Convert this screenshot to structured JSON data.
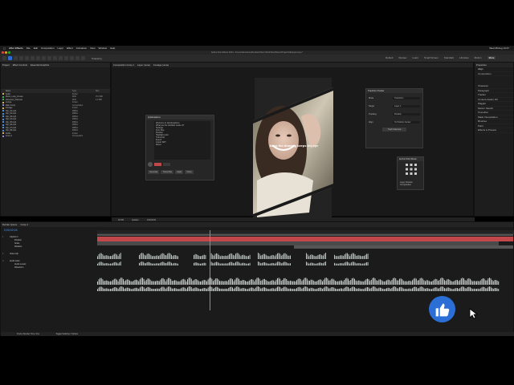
{
  "menubar": {
    "app_name": "After Effects",
    "items": [
      "File",
      "Edit",
      "Composition",
      "Layer",
      "Effect",
      "Animation",
      "View",
      "Window",
      "Help"
    ],
    "clock": "Wed 28 Aug 13:47"
  },
  "window": {
    "title": "Adobe After Effects 2024 - /Users/clientname/Desktop/Client Work/ClientName/Project/AE/project.aep *"
  },
  "toolbar": {
    "snapping_label": "Snapping"
  },
  "workspace": {
    "tabs": [
      "Default",
      "Review",
      "Learn",
      "Small Screen",
      "Standard",
      "Libraries",
      "Motion",
      "More"
    ],
    "active": "More"
  },
  "project_panel": {
    "tabs": [
      "Project",
      "Effect Controls",
      "Essential Graphics"
    ],
    "columns": [
      "Name",
      "Type",
      "Size"
    ],
    "items": [
      {
        "name": "Audio",
        "type": "Folder",
        "size": "",
        "color": "#d9b34a"
      },
      {
        "name": "Music_Loop_01.wav",
        "type": "WAV",
        "size": "15.3 MB",
        "color": "#3fae5a"
      },
      {
        "name": "Voiceover_final.wav",
        "type": "WAV",
        "size": "4.2 MB",
        "color": "#3fae5a"
      },
      {
        "name": "Comps",
        "type": "Folder",
        "size": "",
        "color": "#d9b34a"
      },
      {
        "name": "Main Comp",
        "type": "Composition",
        "size": "",
        "color": "#8a8ad9"
      },
      {
        "name": "Footage",
        "type": "Folder",
        "size": "",
        "color": "#d9b34a"
      },
      {
        "name": "Clip_01.mp4",
        "type": "MPEG",
        "size": "",
        "color": "#4a90d9"
      },
      {
        "name": "Clip_02.mp4",
        "type": "MPEG",
        "size": "",
        "color": "#4a90d9"
      },
      {
        "name": "Clip_03.mp4",
        "type": "MPEG",
        "size": "",
        "color": "#4a90d9"
      },
      {
        "name": "Clip_04.mp4",
        "type": "MPEG",
        "size": "",
        "color": "#4a90d9"
      },
      {
        "name": "Clip_05.mp4",
        "type": "MPEG",
        "size": "",
        "color": "#4a90d9"
      },
      {
        "name": "Clip_06.mp4",
        "type": "MPEG",
        "size": "",
        "color": "#4a90d9"
      },
      {
        "name": "Clip_07.mp4",
        "type": "MPEG",
        "size": "",
        "color": "#4a90d9"
      },
      {
        "name": "Clip_08.mp4",
        "type": "MPEG",
        "size": "",
        "color": "#4a90d9"
      },
      {
        "name": "Solids",
        "type": "Folder",
        "size": "",
        "color": "#d9b34a"
      },
      {
        "name": "Comp 1",
        "type": "Composition",
        "size": "",
        "color": "#8a8ad9"
      }
    ]
  },
  "composition": {
    "tab_label": "Composition Comp 1",
    "layer_tab": "Layer (none)",
    "footage_tab": "Footage (none)",
    "zoom": "33.3%",
    "quality": "Quarter",
    "timecode": "0;00;02;04",
    "caption_text": "Keep the drawing keeps the eye"
  },
  "dialog": {
    "title": "Quickcaptions",
    "lines": [
      "Welcome to Quickcaptions",
      "What are the subtitles made of?",
      "Settings",
      "Font Size",
      "Position",
      "Highlight color",
      "Transcript",
      "Export",
      "Import SRT",
      "Reset"
    ],
    "buttons": [
      "Generate",
      "Transcribe",
      "Apply",
      "Close"
    ]
  },
  "effects_panel": {
    "title": "Transform Tracker",
    "rows": [
      {
        "label": "Mode",
        "value": "Transform"
      },
      {
        "label": "Target",
        "value": "Layer 1"
      },
      {
        "label": "Tracking",
        "value": "Position"
      },
      {
        "label": "Align",
        "value": "To Position Center"
      }
    ],
    "button": "Track Selected"
  },
  "align_panel": {
    "title": "Anchor Point Mover",
    "options": [
      "Layer Position",
      "Composition"
    ]
  },
  "right_panel": {
    "header": "Properties",
    "subheader": "Align",
    "align_to": "Composition",
    "items": [
      "Character",
      "Paragraph",
      "Tracker",
      "Content-Aware Fill",
      "Wiggler",
      "Motion Sketch",
      "Smoother",
      "Mask Interpolation",
      "Brushes",
      "Paint",
      "Effects & Presets"
    ]
  },
  "timeline": {
    "tabs": [
      "Render Queue",
      "Comp 1"
    ],
    "timecode": "0;00;02;04",
    "layers": [
      {
        "num": "1",
        "name": "Caption 1"
      },
      {
        "name": "Position",
        "num": ""
      },
      {
        "name": "Scale",
        "num": ""
      },
      {
        "name": "Rotation",
        "num": ""
      },
      {
        "num": "2",
        "name": "Video clip"
      },
      {
        "num": "3",
        "name": "Audio track"
      },
      {
        "name": "Audio Levels",
        "num": ""
      },
      {
        "name": "Waveform",
        "num": ""
      }
    ],
    "footer_left": "Frame Render Time: 0ms",
    "footer_right": "Toggle Switches / Modes"
  },
  "colors": {
    "accent": "#2d6bd3",
    "like_blue": "#2b6fd6",
    "playhead": "#4a9bff",
    "track_red": "#c2474a"
  },
  "icons": [
    "apple-icon",
    "thumbs-up-icon",
    "cursor-icon",
    "selection-tool-icon",
    "hand-tool-icon"
  ]
}
